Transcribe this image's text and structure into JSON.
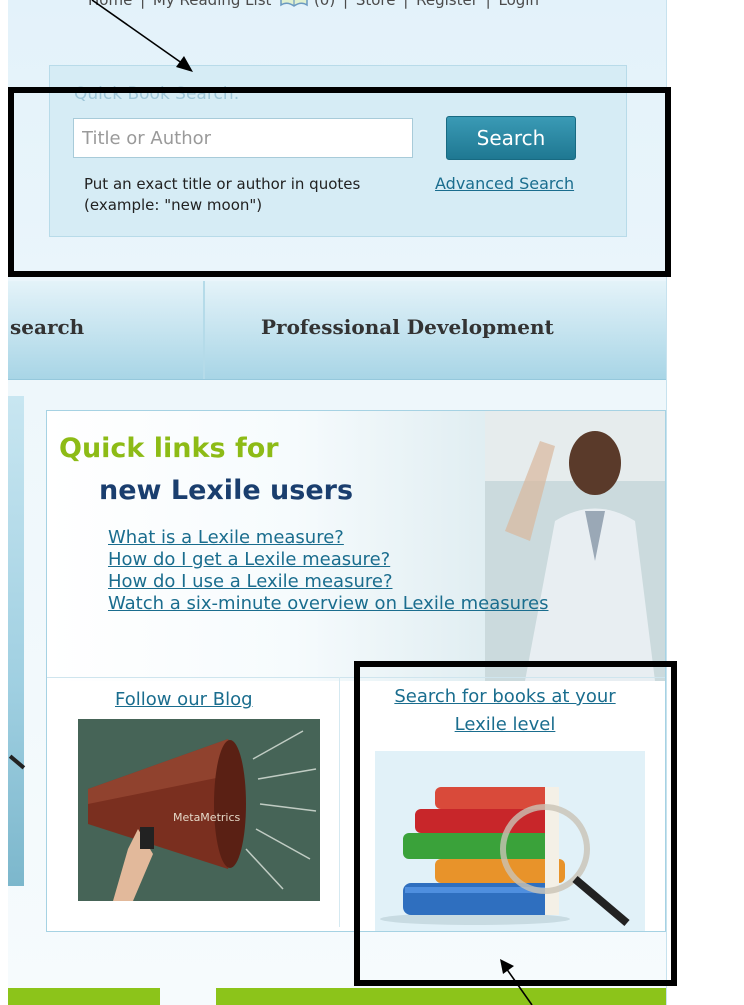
{
  "top_nav": {
    "home": "Home",
    "reading_list": "My Reading List",
    "reading_count": "(0)",
    "store": "Store",
    "register": "Register",
    "login": "Login",
    "separator": "|"
  },
  "search": {
    "label": "Quick Book Search:",
    "placeholder": "Title or Author",
    "button": "Search",
    "hint": "Put an exact title or author in quotes (example: \"new moon\")",
    "advanced": "Advanced Search"
  },
  "tabs": [
    {
      "label": "search"
    },
    {
      "label": "Professional Development"
    }
  ],
  "quick_links": {
    "title_line1": "Quick links for",
    "title_line2": "new Lexile users",
    "links": [
      "What is a Lexile measure?",
      "How do I get a Lexile measure?",
      "How do I use a Lexile measure?",
      "Watch a six-minute overview on Lexile measures"
    ]
  },
  "blog": {
    "link": "Follow our Blog",
    "logo_text": "MetaMetrics"
  },
  "books": {
    "link": "Search for books at your Lexile level"
  },
  "colors": {
    "accent_green": "#8cc41a",
    "title_blue": "#1a3e6e",
    "link_blue": "#1a6d8e",
    "button_teal": "#2a8aa5"
  }
}
